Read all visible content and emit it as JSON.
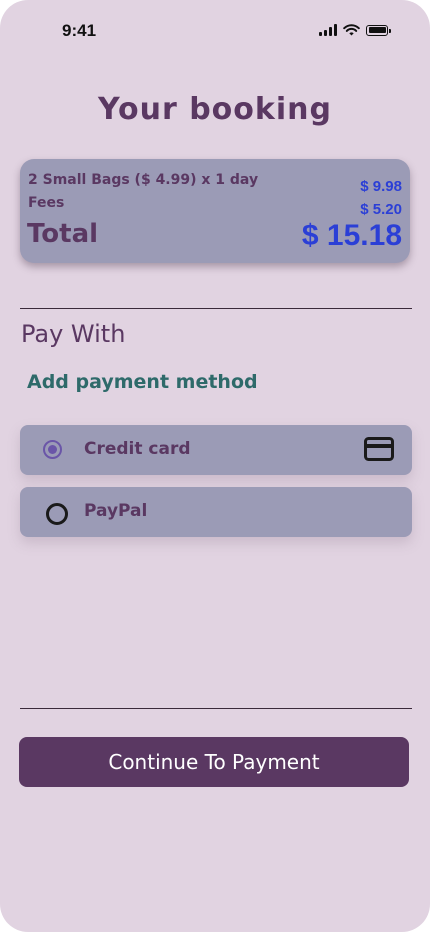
{
  "status_bar": {
    "time": "9:41"
  },
  "header": {
    "title": "Your booking"
  },
  "summary": {
    "bags_line": "2 Small Bags ($ 4.99) x 1 day",
    "bags_price": "$ 9.98",
    "fees_label": "Fees",
    "fees_price": "$ 5.20",
    "total_label": "Total",
    "total_price": "$ 15.18"
  },
  "payment": {
    "section_title": "Pay With",
    "add_method_label": "Add payment method",
    "options": [
      {
        "label": "Credit card",
        "selected": true,
        "icon": "credit-card-icon"
      },
      {
        "label": "PayPal",
        "selected": false
      }
    ]
  },
  "footer": {
    "continue_label": "Continue To Payment"
  },
  "colors": {
    "background": "#e1d3e1",
    "card": "#9b9bb6",
    "primary": "#5a3862",
    "price": "#2b3fd6",
    "link": "#2e6a6a"
  }
}
